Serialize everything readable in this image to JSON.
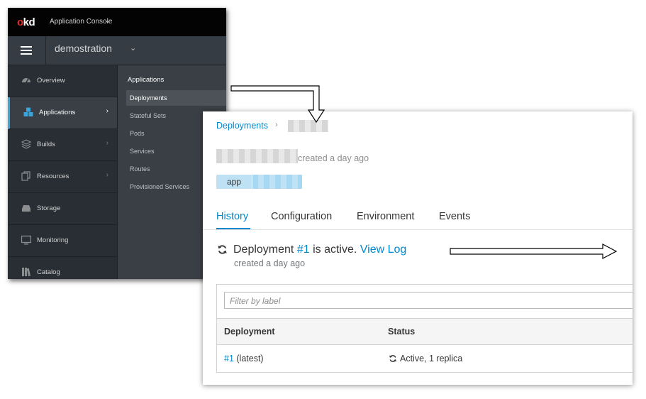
{
  "console": {
    "logo_prefix": "o",
    "logo_suffix": "kd",
    "title": "Application Console",
    "title_caret": "⌄",
    "project": "demostration",
    "project_caret": "⌄",
    "nav": [
      {
        "label": "Overview",
        "icon": "dashboard-icon",
        "arrow": ""
      },
      {
        "label": "Applications",
        "icon": "cubes-icon",
        "arrow": "›",
        "active": true
      },
      {
        "label": "Builds",
        "icon": "layers-icon",
        "arrow": "›"
      },
      {
        "label": "Resources",
        "icon": "copy-icon",
        "arrow": "›"
      },
      {
        "label": "Storage",
        "icon": "storage-icon",
        "arrow": ""
      },
      {
        "label": "Monitoring",
        "icon": "monitor-icon",
        "arrow": ""
      },
      {
        "label": "Catalog",
        "icon": "catalog-icon",
        "arrow": ""
      }
    ],
    "subnav_title": "Applications",
    "subnav": [
      "Deployments",
      "Stateful Sets",
      "Pods",
      "Services",
      "Routes",
      "Provisioned Services"
    ]
  },
  "detail": {
    "breadcrumb": "Deployments",
    "breadcrumb_sep": "›",
    "created": "created a day ago",
    "label_key": "app",
    "tabs": [
      "History",
      "Configuration",
      "Environment",
      "Events"
    ],
    "status_prefix": "Deployment ",
    "deployment_link": "#1",
    "status_middle": " is active. ",
    "view_log": "View Log",
    "status_created": "created a day ago",
    "filter_placeholder": "Filter by label",
    "columns": [
      "Deployment",
      "Status"
    ],
    "row": {
      "deployment": "#1",
      "deployment_suffix": " (latest)",
      "status": "Active, 1 replica"
    }
  },
  "colors": {
    "accent": "#0088ce",
    "nav_active_border": "#39a5dc",
    "logo_red": "#e12c28"
  }
}
